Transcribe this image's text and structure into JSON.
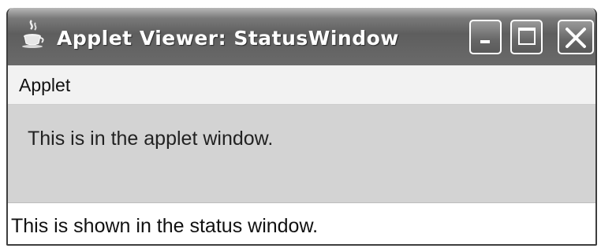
{
  "window": {
    "title": "Applet Viewer: StatusWindow",
    "icon": "java-cup-icon",
    "controls": [
      "minimize-icon",
      "maximize-icon",
      "close-icon"
    ]
  },
  "menubar": {
    "items": [
      {
        "label": "Applet"
      }
    ]
  },
  "applet": {
    "message": "This is in the applet window."
  },
  "status": {
    "message": "This is shown in the status window."
  }
}
